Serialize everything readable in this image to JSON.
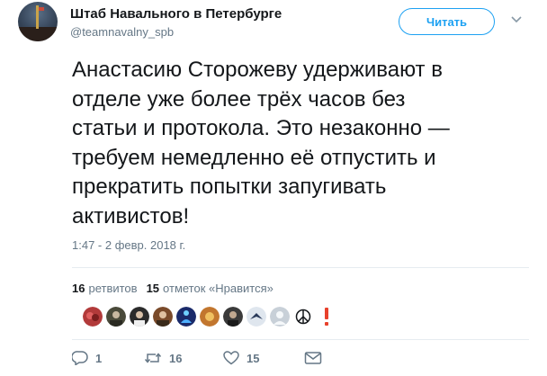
{
  "account": {
    "name": "Штаб Навального в Петербурге",
    "handle": "@teamnavalny_spb"
  },
  "follow_button": {
    "label": "Читать"
  },
  "tweet": {
    "lines": [
      "Анастасию Сторожеву удерживают в",
      "отделе уже более трёх часов без",
      "статьи и протокола. Это незаконно —",
      "требуем немедленно её отпустить и",
      "прекратить попытки запугивать",
      "активистов!"
    ],
    "timestamp": "1:47 - 2 февр. 2018 г."
  },
  "stats": {
    "retweets_count": "16",
    "retweets_label": "ретвитов",
    "likes_count": "15",
    "likes_label": "отметок «Нравится»"
  },
  "likers": [
    {
      "name": "liker-avatar-1",
      "color": "#b23a3a"
    },
    {
      "name": "liker-avatar-2",
      "color": "#4a4a3a"
    },
    {
      "name": "liker-avatar-3",
      "color": "#2b2b2b"
    },
    {
      "name": "liker-avatar-4",
      "color": "#7a4a2a"
    },
    {
      "name": "liker-avatar-5",
      "color": "#1a3a8a"
    },
    {
      "name": "liker-avatar-6",
      "color": "#c2762e"
    },
    {
      "name": "liker-avatar-7",
      "color": "#3a3a3a"
    },
    {
      "name": "liker-avatar-8",
      "color": "#5a6a8a"
    },
    {
      "name": "liker-avatar-9",
      "color": "#b8c0c8"
    }
  ],
  "actions": {
    "reply_count": "1",
    "retweet_count": "16",
    "like_count": "15"
  },
  "colors": {
    "accent": "#1da1f2",
    "muted": "#657786",
    "text": "#14171a",
    "alert": "#e0245e",
    "exclaim": "#e8412c"
  }
}
